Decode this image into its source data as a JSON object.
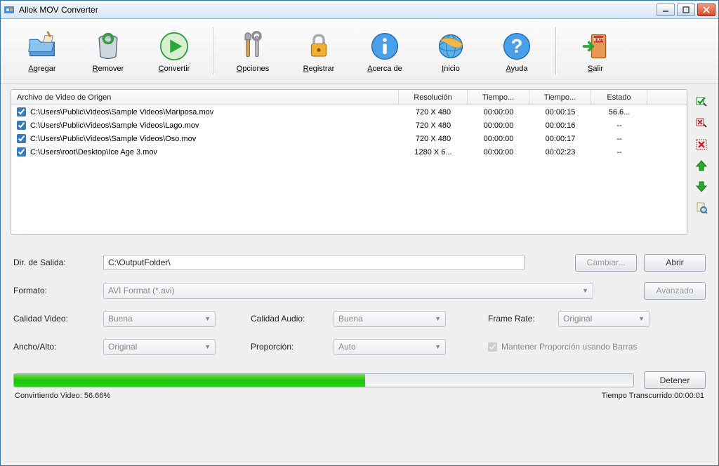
{
  "window": {
    "title": "Allok MOV Converter"
  },
  "toolbar": {
    "agregar": "Agregar",
    "remover": "Remover",
    "convertir": "Convertir",
    "opciones": "Opciones",
    "registrar": "Registrar",
    "acerca": "Acerca de",
    "inicio": "Inicio",
    "ayuda": "Ayuda",
    "salir": "Salir"
  },
  "columns": {
    "path": "Archivo de Video de Origen",
    "res": "Resolución",
    "t1": "Tiempo...",
    "t2": "Tiempo...",
    "state": "Estado"
  },
  "files": [
    {
      "path": "C:\\Users\\Public\\Videos\\Sample Videos\\Mariposa.mov",
      "res": "720 X 480",
      "t1": "00:00:00",
      "t2": "00:00:15",
      "state": "56.6..."
    },
    {
      "path": "C:\\Users\\Public\\Videos\\Sample Videos\\Lago.mov",
      "res": "720 X 480",
      "t1": "00:00:00",
      "t2": "00:00:16",
      "state": "--"
    },
    {
      "path": "C:\\Users\\Public\\Videos\\Sample Videos\\Oso.mov",
      "res": "720 X 480",
      "t1": "00:00:00",
      "t2": "00:00:17",
      "state": "--"
    },
    {
      "path": "C:\\Users\\root\\Desktop\\Ice Age 3.mov",
      "res": "1280 X 6...",
      "t1": "00:00:00",
      "t2": "00:02:23",
      "state": "--"
    }
  ],
  "form": {
    "dirLabel": "Dir. de Salida:",
    "dirValue": "C:\\OutputFolder\\",
    "cambiar": "Cambiar...",
    "abrir": "Abrir",
    "formatoLabel": "Formato:",
    "formatoValue": "AVI Format (*.avi)",
    "avanzado": "Avanzado",
    "calVideoLabel": "Calidad Video:",
    "calVideoValue": "Buena",
    "calAudioLabel": "Calidad Audio:",
    "calAudioValue": "Buena",
    "frameRateLabel": "Frame Rate:",
    "frameRateValue": "Original",
    "anchoLabel": "Ancho/Alto:",
    "anchoValue": "Original",
    "propLabel": "Proporción:",
    "propValue": "Auto",
    "mantener": "Mantener Proporción usando Barras",
    "detener": "Detener"
  },
  "status": {
    "left": "Convirtiendo Video: 56.66%",
    "rightLabel": "Tiempo Transcurrido:",
    "rightValue": "00:00:01",
    "progressPct": "56.66"
  }
}
